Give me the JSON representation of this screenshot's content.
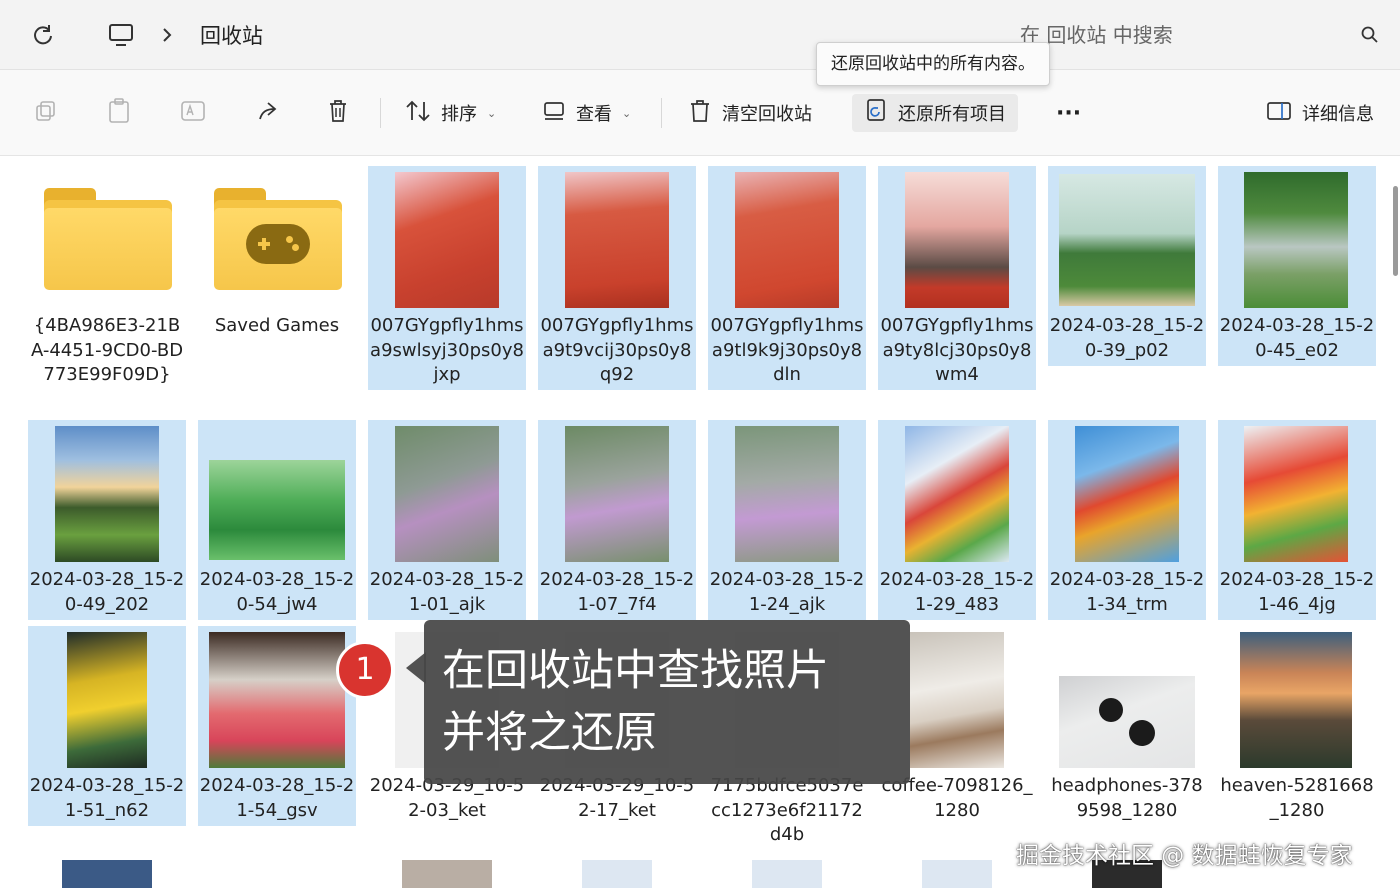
{
  "address_bar": {
    "breadcrumb": "回收站",
    "search_placeholder": "在 回收站 中搜索",
    "icons": [
      "refresh-icon",
      "computer-icon",
      "chevron-right-icon",
      "search-icon"
    ]
  },
  "tooltip": "还原回收站中的所有内容。",
  "commands": {
    "sort": "排序",
    "view": "查看",
    "empty_bin": "清空回收站",
    "restore_all": "还原所有项目",
    "more": "···",
    "details": "详细信息"
  },
  "items": [
    {
      "name": "{4BA986E3-21BA-4451-9CD0-BD773E99F09D}",
      "type": "folder",
      "selected": false
    },
    {
      "name": "Saved Games",
      "type": "games-folder",
      "selected": false
    },
    {
      "name": "007GYgpfly1hmsa9swlsyj30ps0y8jxp",
      "type": "image",
      "selected": true
    },
    {
      "name": "007GYgpfly1hmsa9t9vcij30ps0y8q92",
      "type": "image",
      "selected": true
    },
    {
      "name": "007GYgpfly1hmsa9tl9k9j30ps0y8dln",
      "type": "image",
      "selected": true
    },
    {
      "name": "007GYgpfly1hmsa9ty8lcj30ps0y8wm4",
      "type": "image",
      "selected": true
    },
    {
      "name": "2024-03-28_15-20-39_p02",
      "type": "image",
      "selected": true
    },
    {
      "name": "2024-03-28_15-20-45_e02",
      "type": "image",
      "selected": true
    },
    {
      "name": "2024-03-28_15-20-49_202",
      "type": "image",
      "selected": true
    },
    {
      "name": "2024-03-28_15-20-54_jw4",
      "type": "image",
      "selected": true
    },
    {
      "name": "2024-03-28_15-21-01_ajk",
      "type": "image",
      "selected": true
    },
    {
      "name": "2024-03-28_15-21-07_7f4",
      "type": "image",
      "selected": true
    },
    {
      "name": "2024-03-28_15-21-24_ajk",
      "type": "image",
      "selected": true
    },
    {
      "name": "2024-03-28_15-21-29_483",
      "type": "image",
      "selected": true
    },
    {
      "name": "2024-03-28_15-21-34_trm",
      "type": "image",
      "selected": true
    },
    {
      "name": "2024-03-28_15-21-46_4jg",
      "type": "image",
      "selected": true
    },
    {
      "name": "2024-03-28_15-21-51_n62",
      "type": "image",
      "selected": true
    },
    {
      "name": "2024-03-28_15-21-54_gsv",
      "type": "image",
      "selected": true
    },
    {
      "name": "2024-03-29_10-52-03_ket",
      "type": "image",
      "selected": false
    },
    {
      "name": "2024-03-29_10-52-17_ket",
      "type": "image",
      "selected": false
    },
    {
      "name": "7175bdfce5037ecc1273e6f21172d4b",
      "type": "image",
      "selected": false
    },
    {
      "name": "coffee-7098126_1280",
      "type": "image",
      "selected": false
    },
    {
      "name": "headphones-3789598_1280",
      "type": "image",
      "selected": false
    },
    {
      "name": "heaven-5281668_1280",
      "type": "image",
      "selected": false
    }
  ],
  "callout": {
    "badge": "1",
    "line1": "在回收站中查找照片",
    "line2": "并将之还原"
  },
  "watermark": "掘金技术社区 @ 数据蛙恢复专家",
  "colors": {
    "selection": "#cce4f7",
    "folder": "#f5c443",
    "badge": "#d9342f",
    "callout_bg": "#464646"
  }
}
